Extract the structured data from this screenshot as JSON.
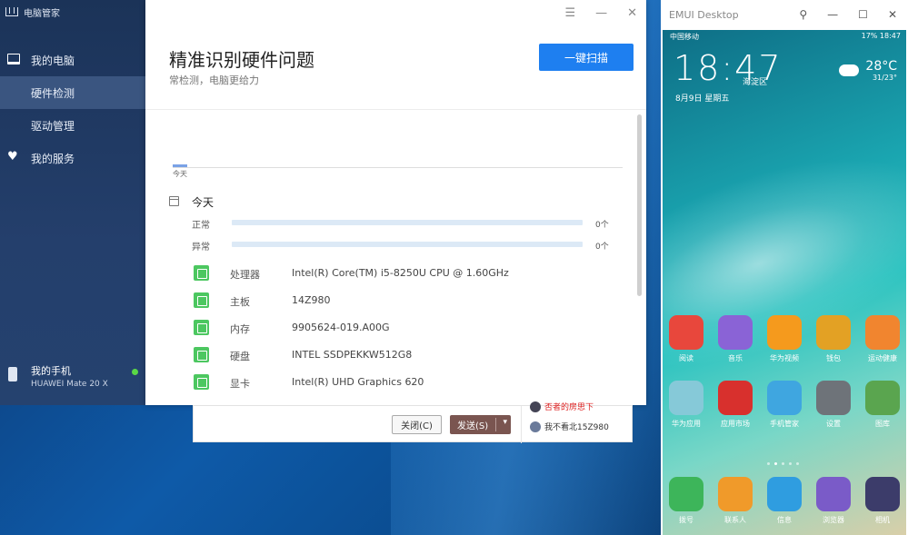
{
  "sidebar": {
    "app_title": "电脑管家",
    "items": [
      {
        "label": "我的电脑"
      },
      {
        "label": "硬件检测"
      },
      {
        "label": "驱动管理"
      },
      {
        "label": "我的服务"
      }
    ],
    "phone_name": "我的手机",
    "phone_model": "HUAWEI Mate 20 X",
    "status_color": "#5ad846"
  },
  "main": {
    "title": "精准识别硬件问题",
    "subtitle": "常检测，电脑更给力",
    "scan_button": "一键扫描",
    "timeline_label": "今天",
    "day": "今天",
    "stats": [
      {
        "label": "正常",
        "count": "0个"
      },
      {
        "label": "异常",
        "count": "0个"
      }
    ],
    "hardware": [
      {
        "name": "处理器",
        "value": "Intel(R) Core(TM) i5-8250U CPU @ 1.60GHz",
        "icon": "cpu-icon"
      },
      {
        "name": "主板",
        "value": "14Z980",
        "icon": "motherboard-icon"
      },
      {
        "name": "内存",
        "value": "9905624-019.A00G",
        "icon": "memory-icon"
      },
      {
        "name": "硬盘",
        "value": "INTEL SSDPEKKW512G8",
        "icon": "disk-icon"
      },
      {
        "name": "显卡",
        "value": "Intel(R) UHD Graphics 620",
        "icon": "gpu-icon"
      }
    ],
    "accent": "#1e7ff0"
  },
  "chat": {
    "close_label": "关闭(C)",
    "send_label": "发送(S)",
    "contacts": [
      {
        "name": "否者的房思下"
      },
      {
        "name": "我不看北15Z980"
      }
    ]
  },
  "emui": {
    "window_title": "EMUI Desktop",
    "status_left": "中国移动",
    "status_right": "17% 18:47",
    "clock": "18:47",
    "city": "海淀区",
    "date": "8月9日 星期五",
    "temp": "28°C",
    "temp_range": "31/23°",
    "apps": [
      {
        "label": "阅读",
        "color": "#e8473c"
      },
      {
        "label": "音乐",
        "color": "#8a63d6"
      },
      {
        "label": "华为视频",
        "color": "#f59a1d"
      },
      {
        "label": "钱包",
        "color": "#e3a124"
      },
      {
        "label": "运动健康",
        "color": "#f1852f"
      },
      {
        "label": "华为应用",
        "color": "#86c9d8"
      },
      {
        "label": "应用市场",
        "color": "#d8302d"
      },
      {
        "label": "手机管家",
        "color": "#3fa6e0"
      },
      {
        "label": "设置",
        "color": "#6e7379"
      },
      {
        "label": "图库",
        "color": "#5aa54f"
      },
      {
        "label": "拨号",
        "color": "#3db55a"
      },
      {
        "label": "联系人",
        "color": "#f09a2a"
      },
      {
        "label": "信息",
        "color": "#2f9de0"
      },
      {
        "label": "浏览器",
        "color": "#7a5bc8"
      },
      {
        "label": "相机",
        "color": "#3c3c6a"
      }
    ]
  }
}
